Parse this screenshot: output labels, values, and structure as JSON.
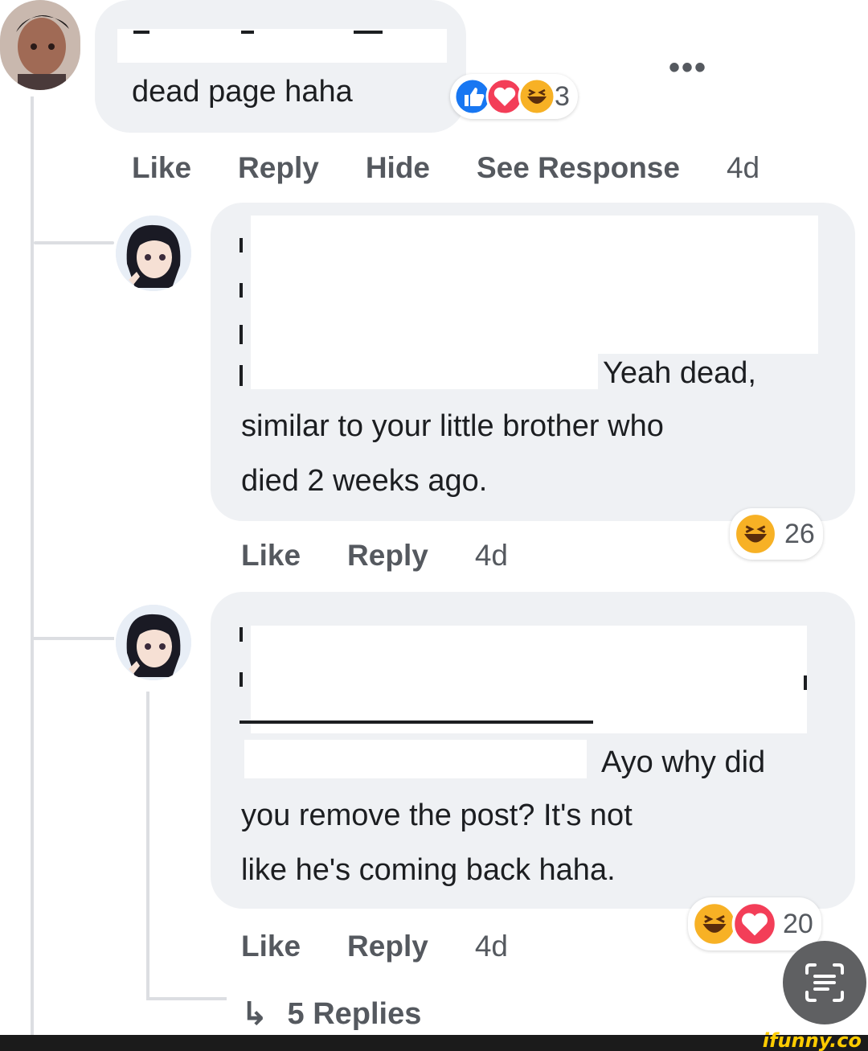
{
  "comments": [
    {
      "text": "dead page haha",
      "actions": [
        "Like",
        "Reply",
        "Hide",
        "See Response"
      ],
      "time": "4d",
      "reaction_count": "3",
      "reactions": [
        "like-icon",
        "love-icon",
        "haha-icon"
      ],
      "more": "•••"
    },
    {
      "text_line1": "Yeah dead,",
      "text_line2": "similar to your little brother who",
      "text_line3": "died 2 weeks ago.",
      "actions": [
        "Like",
        "Reply"
      ],
      "time": "4d",
      "reaction_count": "26",
      "reactions": [
        "haha-icon"
      ]
    },
    {
      "text_line1": "Ayo why did",
      "text_line2": "you remove the post? It's not",
      "text_line3": "like he's coming back haha.",
      "actions": [
        "Like",
        "Reply"
      ],
      "time": "4d",
      "reaction_count": "20",
      "reactions": [
        "haha-icon",
        "love-icon"
      ]
    }
  ],
  "replies_link": "5 Replies",
  "watermark": "ifunny.co",
  "colors": {
    "like": "#1877f2",
    "love": "#f33e58",
    "haha": "#f7b125",
    "bubble": "#eff1f4"
  }
}
